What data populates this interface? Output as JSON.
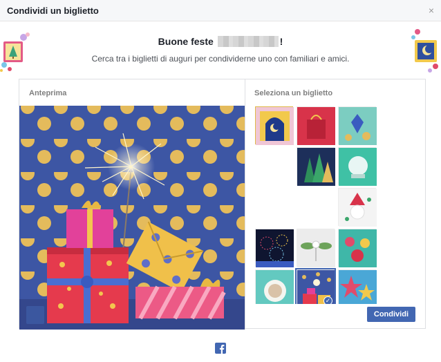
{
  "dialog": {
    "title": "Condividi un biglietto",
    "close_icon": "×"
  },
  "greeting": {
    "prefix": "Buone feste",
    "suffix": "!",
    "subtitle": "Cerca tra i biglietti di auguri per condividerne uno con familiari e amici."
  },
  "preview": {
    "label": "Anteprima",
    "selected_card": "sparkler-gifts"
  },
  "selector": {
    "label": "Seleziona un biglietto",
    "cards": [
      {
        "id": "night-arch",
        "icon": "crescent-moon-card",
        "selected": false
      },
      {
        "id": "red-bag",
        "icon": "gift-bag-card",
        "selected": false
      },
      {
        "id": "dreidel",
        "icon": "dreidel-coins-card",
        "selected": false
      },
      {
        "id": "trees",
        "icon": "paper-trees-card",
        "selected": false
      },
      {
        "id": "snowman",
        "icon": "snow-globe-card",
        "selected": false
      },
      {
        "id": "santa",
        "icon": "paper-santa-card",
        "selected": false
      },
      {
        "id": "fireworks",
        "icon": "fireworks-card",
        "selected": false
      },
      {
        "id": "angel",
        "icon": "leaf-angel-card",
        "selected": false
      },
      {
        "id": "ornaments",
        "icon": "ornaments-card",
        "selected": false
      },
      {
        "id": "cocoa",
        "icon": "hot-cocoa-card",
        "selected": false
      },
      {
        "id": "sparkler-gifts",
        "icon": "sparkler-gifts-card",
        "selected": true
      },
      {
        "id": "stars",
        "icon": "paper-stars-card",
        "selected": false
      }
    ]
  },
  "actions": {
    "share_label": "Condividi"
  },
  "colors": {
    "accent": "#4267b2",
    "preview_background": "#3d56a4"
  }
}
